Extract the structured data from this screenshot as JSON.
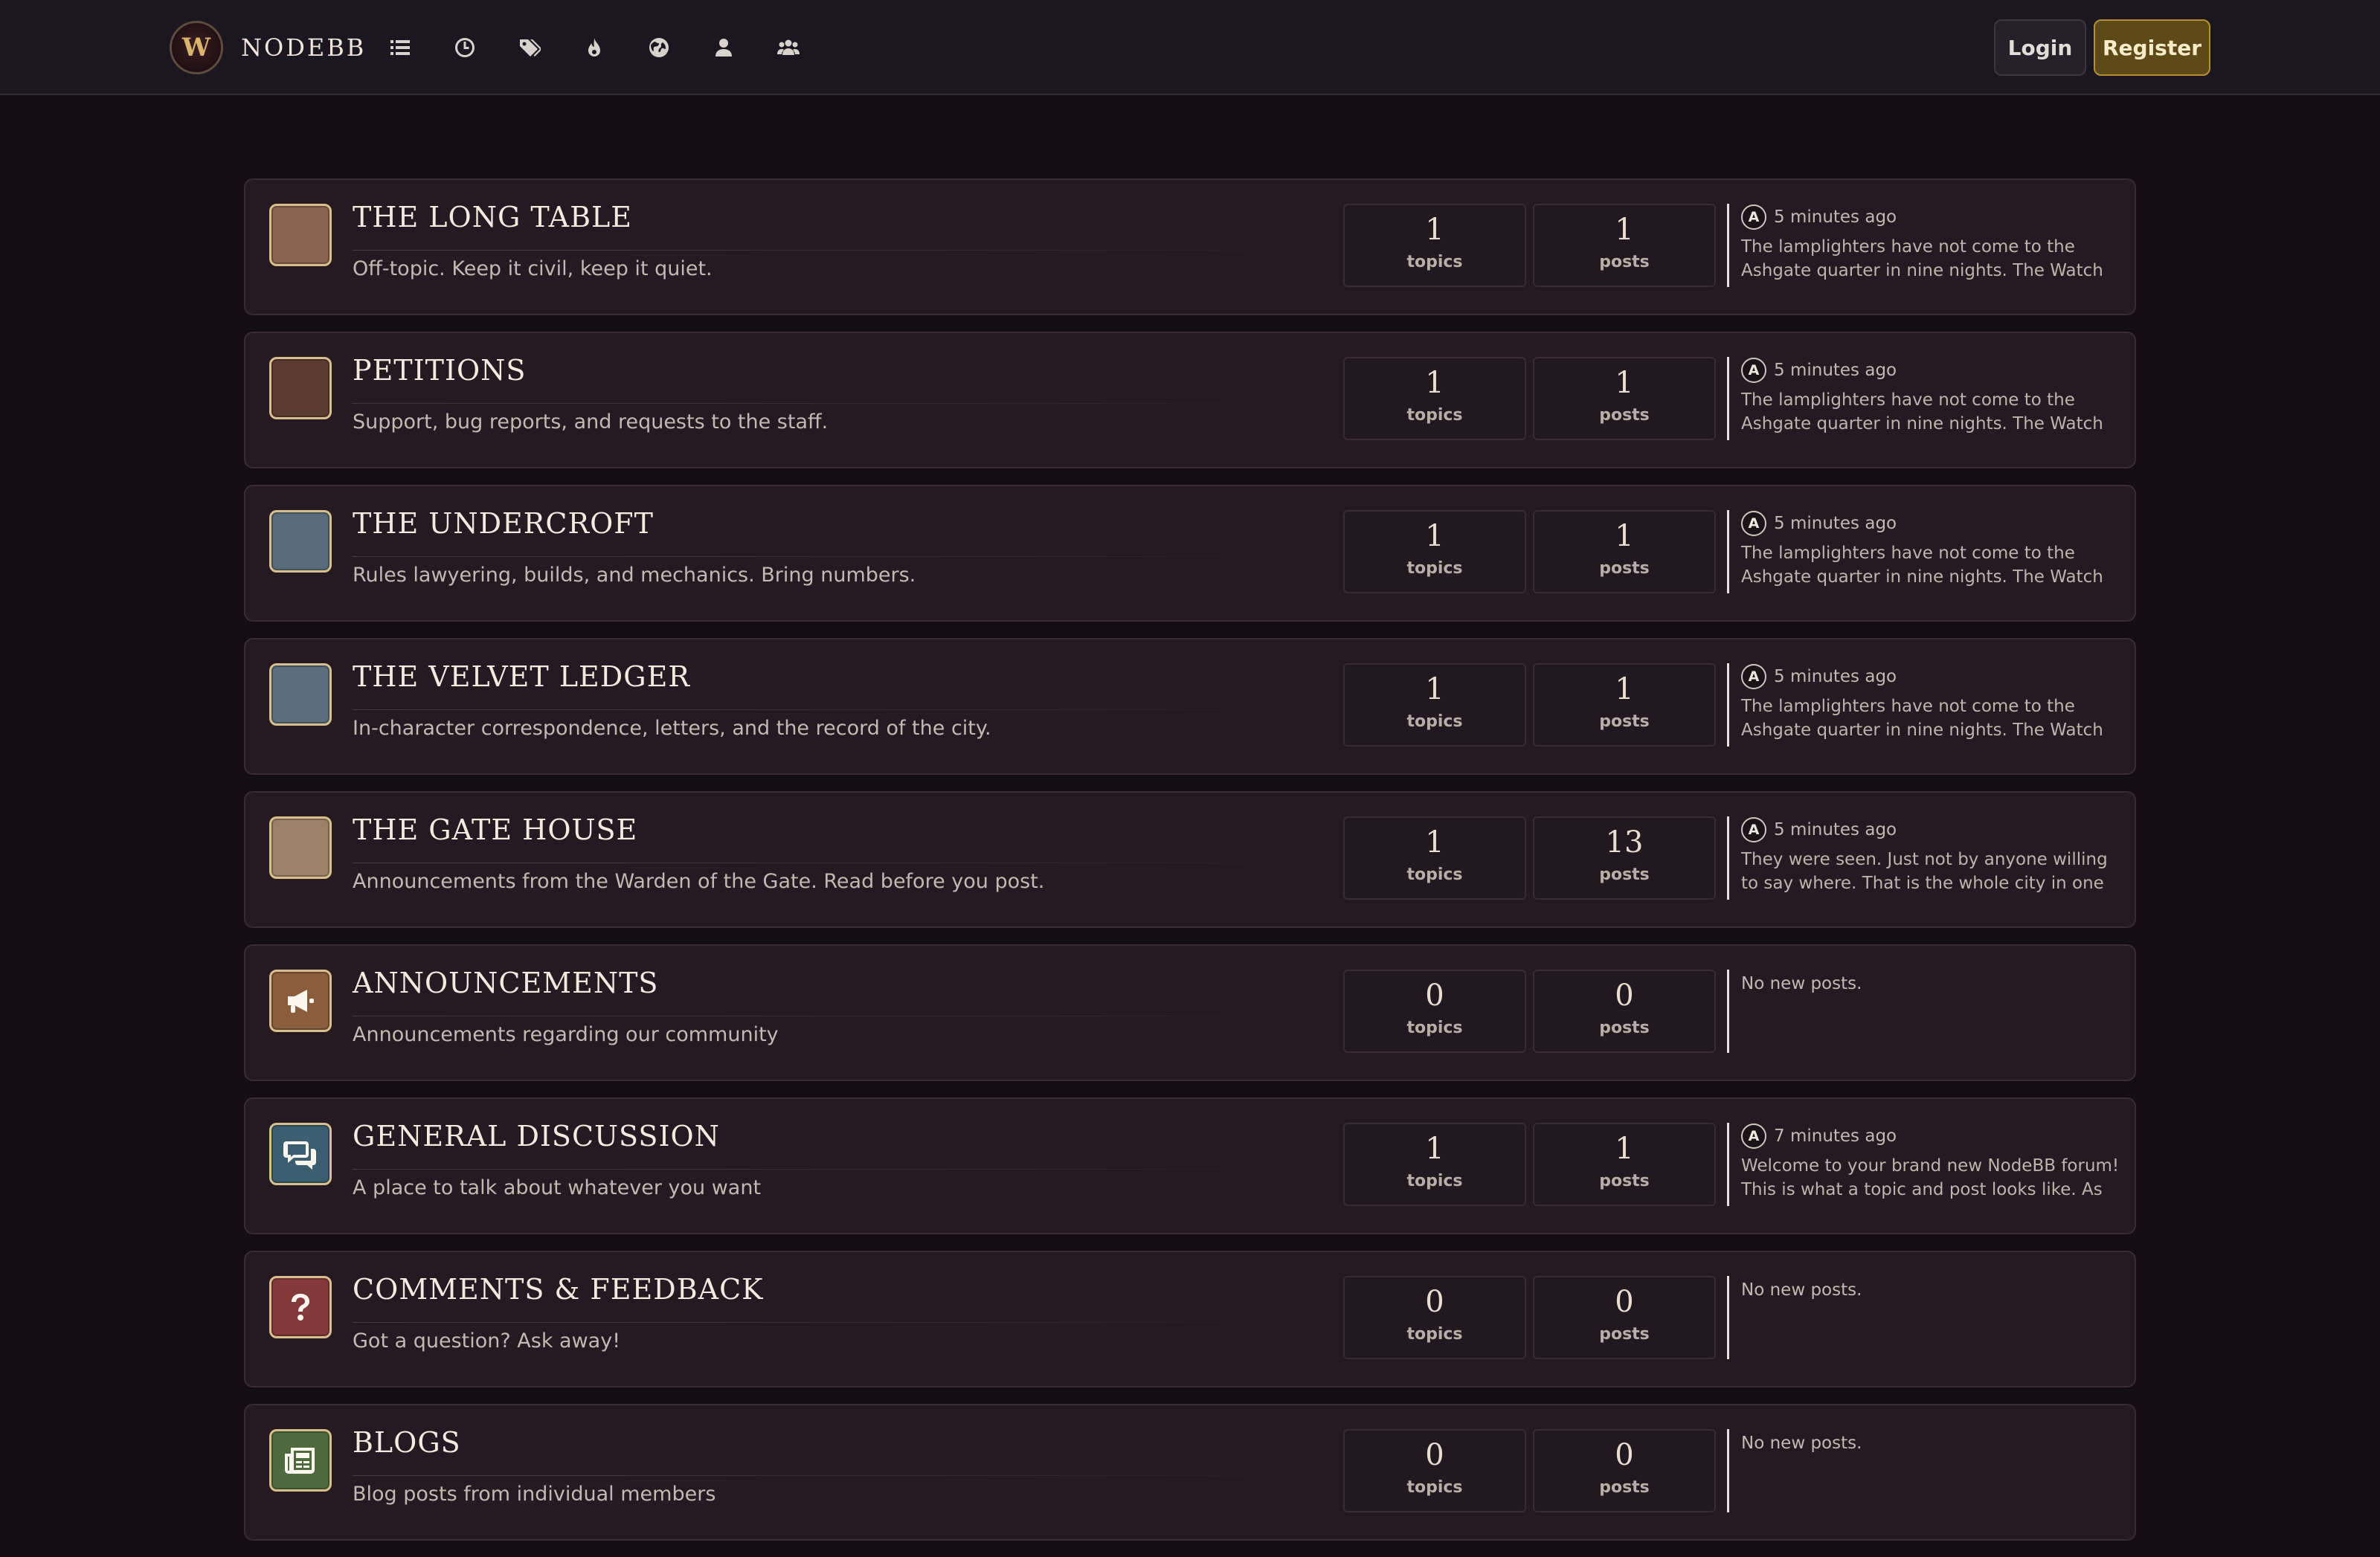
{
  "brand": {
    "logo_letter": "W",
    "name": "NODEBB"
  },
  "nav": {
    "icons": [
      "categories-icon",
      "recent-icon",
      "tags-icon",
      "popular-icon",
      "world-icon",
      "users-icon",
      "groups-icon"
    ]
  },
  "auth": {
    "login": "Login",
    "register": "Register"
  },
  "labels": {
    "topics": "topics",
    "posts": "posts",
    "no_posts": "No new posts."
  },
  "categories": [
    {
      "title": "THE LONG TABLE",
      "description": "Off-topic. Keep it civil, keep it quiet.",
      "topics": "1",
      "posts": "1",
      "icon_color": "#8a6450",
      "icon": "",
      "last_avatar": "A",
      "last_time": "5 minutes ago",
      "last_text": "The lamplighters have not come to the Ashgate quarter in nine nights. The Watch says this is ..."
    },
    {
      "title": "PETITIONS",
      "description": "Support, bug reports, and requests to the staff.",
      "topics": "1",
      "posts": "1",
      "icon_color": "#5c3b32",
      "icon": "",
      "last_avatar": "A",
      "last_time": "5 minutes ago",
      "last_text": "The lamplighters have not come to the Ashgate quarter in nine nights. The Watch says this is ..."
    },
    {
      "title": "THE UNDERCROFT",
      "description": "Rules lawyering, builds, and mechanics. Bring numbers.",
      "topics": "1",
      "posts": "1",
      "icon_color": "#596b78",
      "icon": "",
      "last_avatar": "A",
      "last_time": "5 minutes ago",
      "last_text": "The lamplighters have not come to the Ashgate quarter in nine nights. The Watch says this is ..."
    },
    {
      "title": "THE VELVET LEDGER",
      "description": "In-character correspondence, letters, and the record of the city.",
      "topics": "1",
      "posts": "1",
      "icon_color": "#5a6e7c",
      "icon": "",
      "last_avatar": "A",
      "last_time": "5 minutes ago",
      "last_text": "The lamplighters have not come to the Ashgate quarter in nine nights. The Watch says this is ..."
    },
    {
      "title": "THE GATE HOUSE",
      "description": "Announcements from the Warden of the Gate. Read before you post.",
      "topics": "1",
      "posts": "13",
      "icon_color": "#9b8168",
      "icon": "",
      "last_avatar": "A",
      "last_time": "5 minutes ago",
      "last_text": "They were seen. Just not by anyone willing to say where. That is the whole city in one line, a..."
    },
    {
      "title": "ANNOUNCEMENTS",
      "description": "Announcements regarding our community",
      "topics": "0",
      "posts": "0",
      "icon_color": "#8c5d3c",
      "icon": "bullhorn-icon",
      "last_avatar": "",
      "last_time": "",
      "last_text": ""
    },
    {
      "title": "GENERAL DISCUSSION",
      "description": "A place to talk about whatever you want",
      "topics": "1",
      "posts": "1",
      "icon_color": "#3b5f70",
      "icon": "comments-icon",
      "last_avatar": "A",
      "last_time": "7 minutes ago",
      "last_text": "Welcome to your brand new NodeBB forum! This is what a topic and post looks like. As an..."
    },
    {
      "title": "COMMENTS & FEEDBACK",
      "description": "Got a question? Ask away!",
      "topics": "0",
      "posts": "0",
      "icon_color": "#843a3a",
      "icon": "question-icon",
      "last_avatar": "",
      "last_time": "",
      "last_text": ""
    },
    {
      "title": "BLOGS",
      "description": "Blog posts from individual members",
      "topics": "0",
      "posts": "0",
      "icon_color": "#4f6b3d",
      "icon": "newspaper-icon",
      "last_avatar": "",
      "last_time": "",
      "last_text": ""
    }
  ]
}
